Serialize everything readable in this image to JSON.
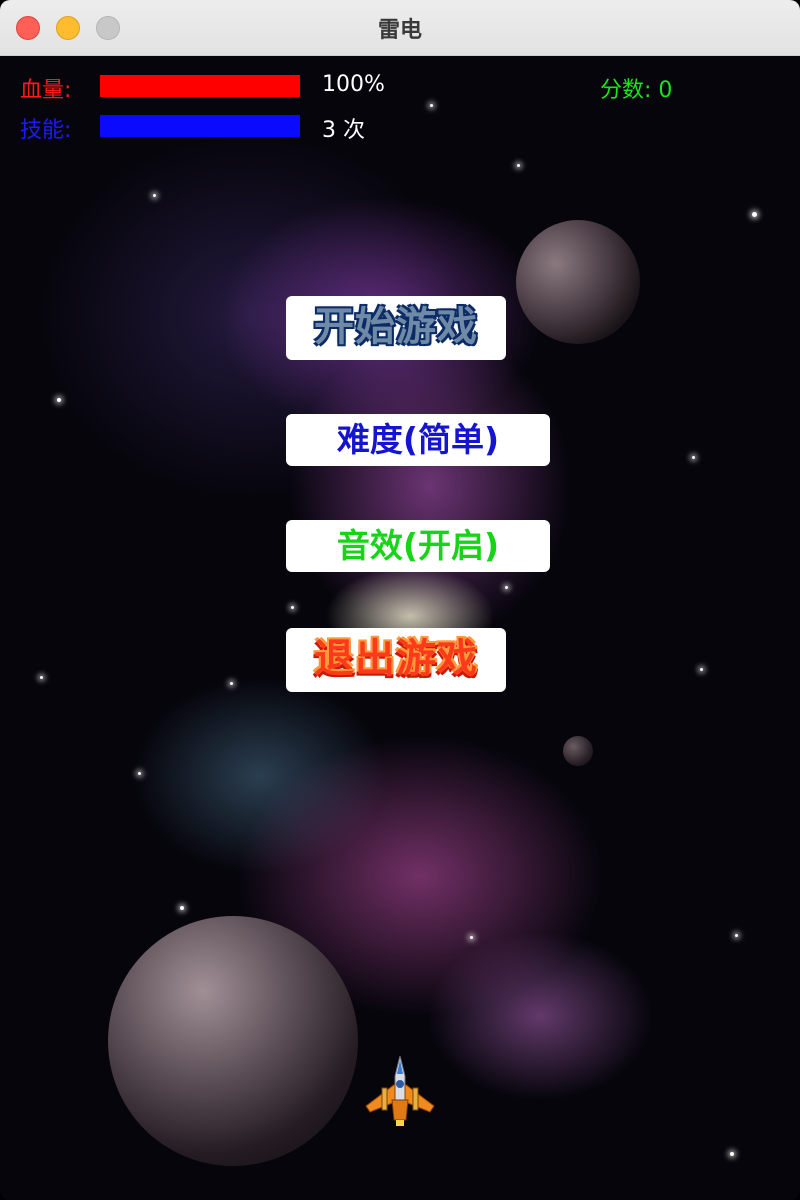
{
  "window": {
    "title": "雷电"
  },
  "hud": {
    "hp_label": "血量:",
    "hp_percent": 100,
    "hp_value_text": "100%",
    "skill_label": "技能:",
    "skill_fill": 1.0,
    "skill_count_text": "3 次",
    "score_text": "分数:  0",
    "colors": {
      "hp": "#ff0000",
      "skill": "#0a0aff",
      "score": "#19e619"
    }
  },
  "menu": {
    "start_label": "开始游戏",
    "difficulty_label": "难度(简单)",
    "sound_label": "音效(开启)",
    "exit_label": "退出游戏"
  },
  "icons": {
    "close": "close-icon",
    "minimize": "minimize-icon",
    "maximize": "maximize-icon",
    "player": "fighter-jet-icon"
  }
}
